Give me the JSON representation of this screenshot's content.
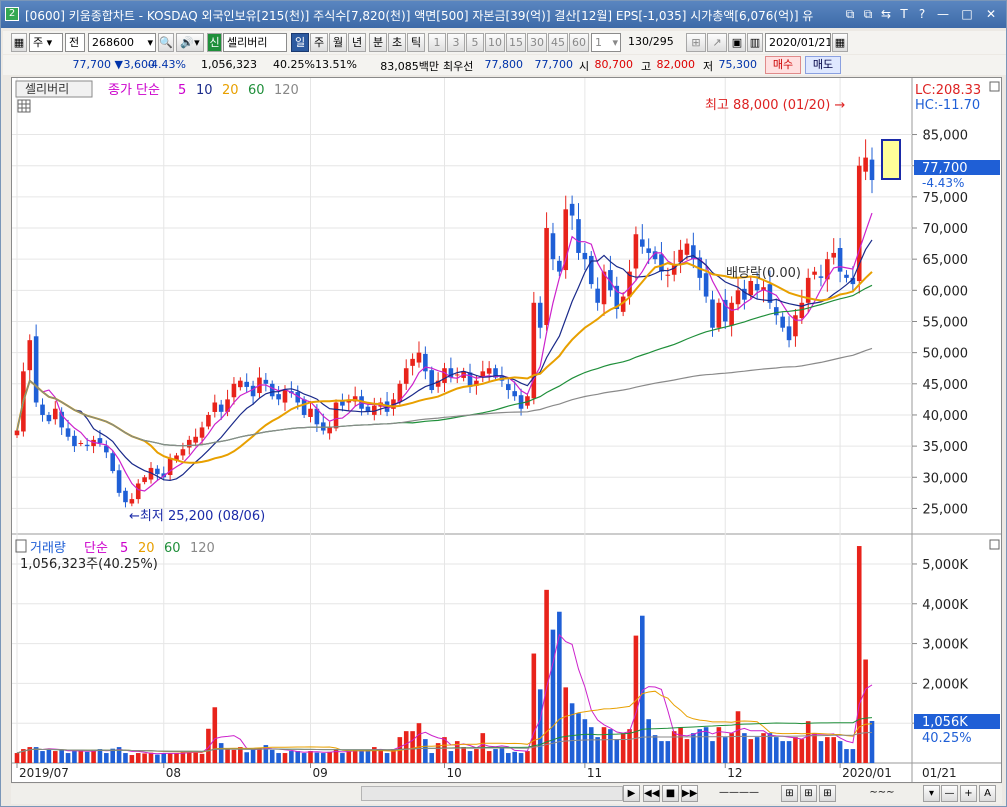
{
  "window": {
    "title": "[0600] 키움종합차트 - KOSDAQ 외국인보유[215(천)] 주식수[7,820(천)] 액면[500] 자본금[39(억)] 결산[12월] EPS[-1,035] 시가총액[6,076(억)] 유",
    "icon_label": "2",
    "buttons": [
      "⧉",
      "⧉",
      "⇆",
      "T",
      "?",
      "—",
      "□",
      "✕"
    ]
  },
  "toolbar": {
    "mode_label": "주",
    "mode2_label": "전",
    "code": "268600",
    "sin_label": "신",
    "stock_name": "셀리버리",
    "periods": [
      "일",
      "주",
      "월",
      "년",
      "분",
      "초",
      "틱"
    ],
    "selected_period": "일",
    "intervals": [
      "1",
      "3",
      "5",
      "10",
      "15",
      "30",
      "45",
      "60"
    ],
    "count_value": "1",
    "pager": "130/295",
    "date": "2020/01/21"
  },
  "quote": {
    "price": "77,700",
    "arrow": "▼",
    "change": "3,600",
    "change_pct": "-4.43%",
    "volume": "1,056,323",
    "vol_ratio": "40.25%",
    "turnover": "13.51%",
    "amount": "83,085백만",
    "hoga_label": "최우선",
    "ask": "77,800",
    "bid": "77,700",
    "open_label": "시",
    "open": "80,700",
    "high_label": "고",
    "high": "82,000",
    "low_label": "저",
    "low": "75,300",
    "buy_label": "매수",
    "sell_label": "매도"
  },
  "price_panel": {
    "stock_tag": "셀리버리",
    "ma_title": "종가 단순",
    "ma_periods": [
      "5",
      "10",
      "20",
      "60",
      "120"
    ],
    "lc_label": "LC:208.33",
    "hc_label": "HC:-11.70",
    "max_note": "최고 88,000 (01/20) →",
    "min_note": "←최저 25,200 (08/06)",
    "dividend_note": "배당락(0.00)",
    "current_price_tag": "77,700",
    "current_pct_tag": "-4.43%"
  },
  "volume_panel": {
    "title": "거래량",
    "ma_title": "단순",
    "ma_periods": [
      "5",
      "20",
      "60",
      "120"
    ],
    "current_volume": "1,056,323주(40.25%)",
    "current_tag": "1,056K",
    "current_pct": "40.25%"
  },
  "colors": {
    "up": "#e8231b",
    "down": "#1f5fd6",
    "ma5": "#cc22cc",
    "ma10": "#1a2a8a",
    "ma20": "#e8a000",
    "ma60": "#1f8f3a",
    "ma120": "#8a8a8a"
  },
  "chart_data": {
    "type": "candlestick",
    "x_labels": [
      "2019/07",
      "08",
      "09",
      "10",
      "11",
      "12",
      "2020/01"
    ],
    "x_last_label": "01/21",
    "price_ticks": [
      "25,000",
      "30,000",
      "35,000",
      "40,000",
      "45,000",
      "50,000",
      "55,000",
      "60,000",
      "65,000",
      "70,000",
      "75,000",
      "80,000",
      "85,000"
    ],
    "price_ylim": [
      21700,
      89900
    ],
    "volume_ticks": [
      "1,000K",
      "2,000K",
      "3,000K",
      "4,000K",
      "5,000K"
    ],
    "volume_ylim": [
      0,
      5200
    ],
    "closes": [
      37500,
      47000,
      52000,
      42000,
      40000,
      39000,
      41000,
      38000,
      36500,
      35000,
      35500,
      35000,
      36000,
      35500,
      34000,
      31000,
      27500,
      26000,
      26500,
      29000,
      30000,
      31500,
      30500,
      30000,
      33000,
      33500,
      34500,
      36000,
      36500,
      38000,
      40000,
      42000,
      40500,
      42500,
      45000,
      45500,
      44500,
      43000,
      46000,
      45000,
      43000,
      42500,
      44000,
      43500,
      42000,
      40000,
      41000,
      38500,
      37500,
      38000,
      42000,
      41500,
      42500,
      43000,
      41000,
      40500,
      41500,
      42000,
      40500,
      42500,
      45000,
      47500,
      49000,
      50000,
      47000,
      44000,
      45500,
      47500,
      46000,
      46500,
      47000,
      44500,
      45500,
      47000,
      47500,
      46000,
      45500,
      44000,
      43000,
      41000,
      43000,
      58000,
      54000,
      70000,
      65000,
      63000,
      73000,
      72000,
      66000,
      65000,
      61000,
      58000,
      63000,
      60000,
      57000,
      59000,
      63000,
      69000,
      67000,
      66000,
      65000,
      63000,
      62500,
      64000,
      66500,
      67500,
      65000,
      62000,
      59000,
      54000,
      58000,
      55000,
      58000,
      60000,
      58500,
      61500,
      60000,
      60500,
      58000,
      56000,
      54000,
      52000,
      56000,
      58000,
      62000,
      63000,
      62000,
      65000,
      66000,
      63000,
      62000,
      61000,
      80000,
      81300,
      77700
    ],
    "volumes": [
      250,
      350,
      400,
      400,
      300,
      350,
      300,
      330,
      250,
      300,
      330,
      280,
      330,
      350,
      250,
      360,
      400,
      250,
      200,
      250,
      240,
      260,
      210,
      240,
      250,
      250,
      270,
      300,
      270,
      230,
      860,
      1400,
      500,
      350,
      330,
      400,
      270,
      350,
      380,
      450,
      330,
      250,
      250,
      300,
      300,
      250,
      300,
      260,
      250,
      280,
      350,
      250,
      310,
      330,
      300,
      330,
      400,
      350,
      250,
      350,
      650,
      800,
      800,
      1000,
      600,
      250,
      500,
      650,
      300,
      550,
      400,
      300,
      350,
      750,
      300,
      350,
      400,
      250,
      280,
      250,
      300,
      2750,
      1850,
      4350,
      3350,
      3800,
      1900,
      1500,
      1250,
      1100,
      900,
      650,
      900,
      850,
      600,
      750,
      850,
      3200,
      3700,
      1100,
      700,
      550,
      550,
      800,
      900,
      600,
      750,
      850,
      900,
      550,
      900,
      650,
      750,
      1300,
      750,
      600,
      650,
      750,
      750,
      650,
      550,
      550,
      650,
      600,
      1050,
      750,
      550,
      650,
      650,
      550,
      350,
      350,
      5450,
      2600,
      1056
    ]
  }
}
